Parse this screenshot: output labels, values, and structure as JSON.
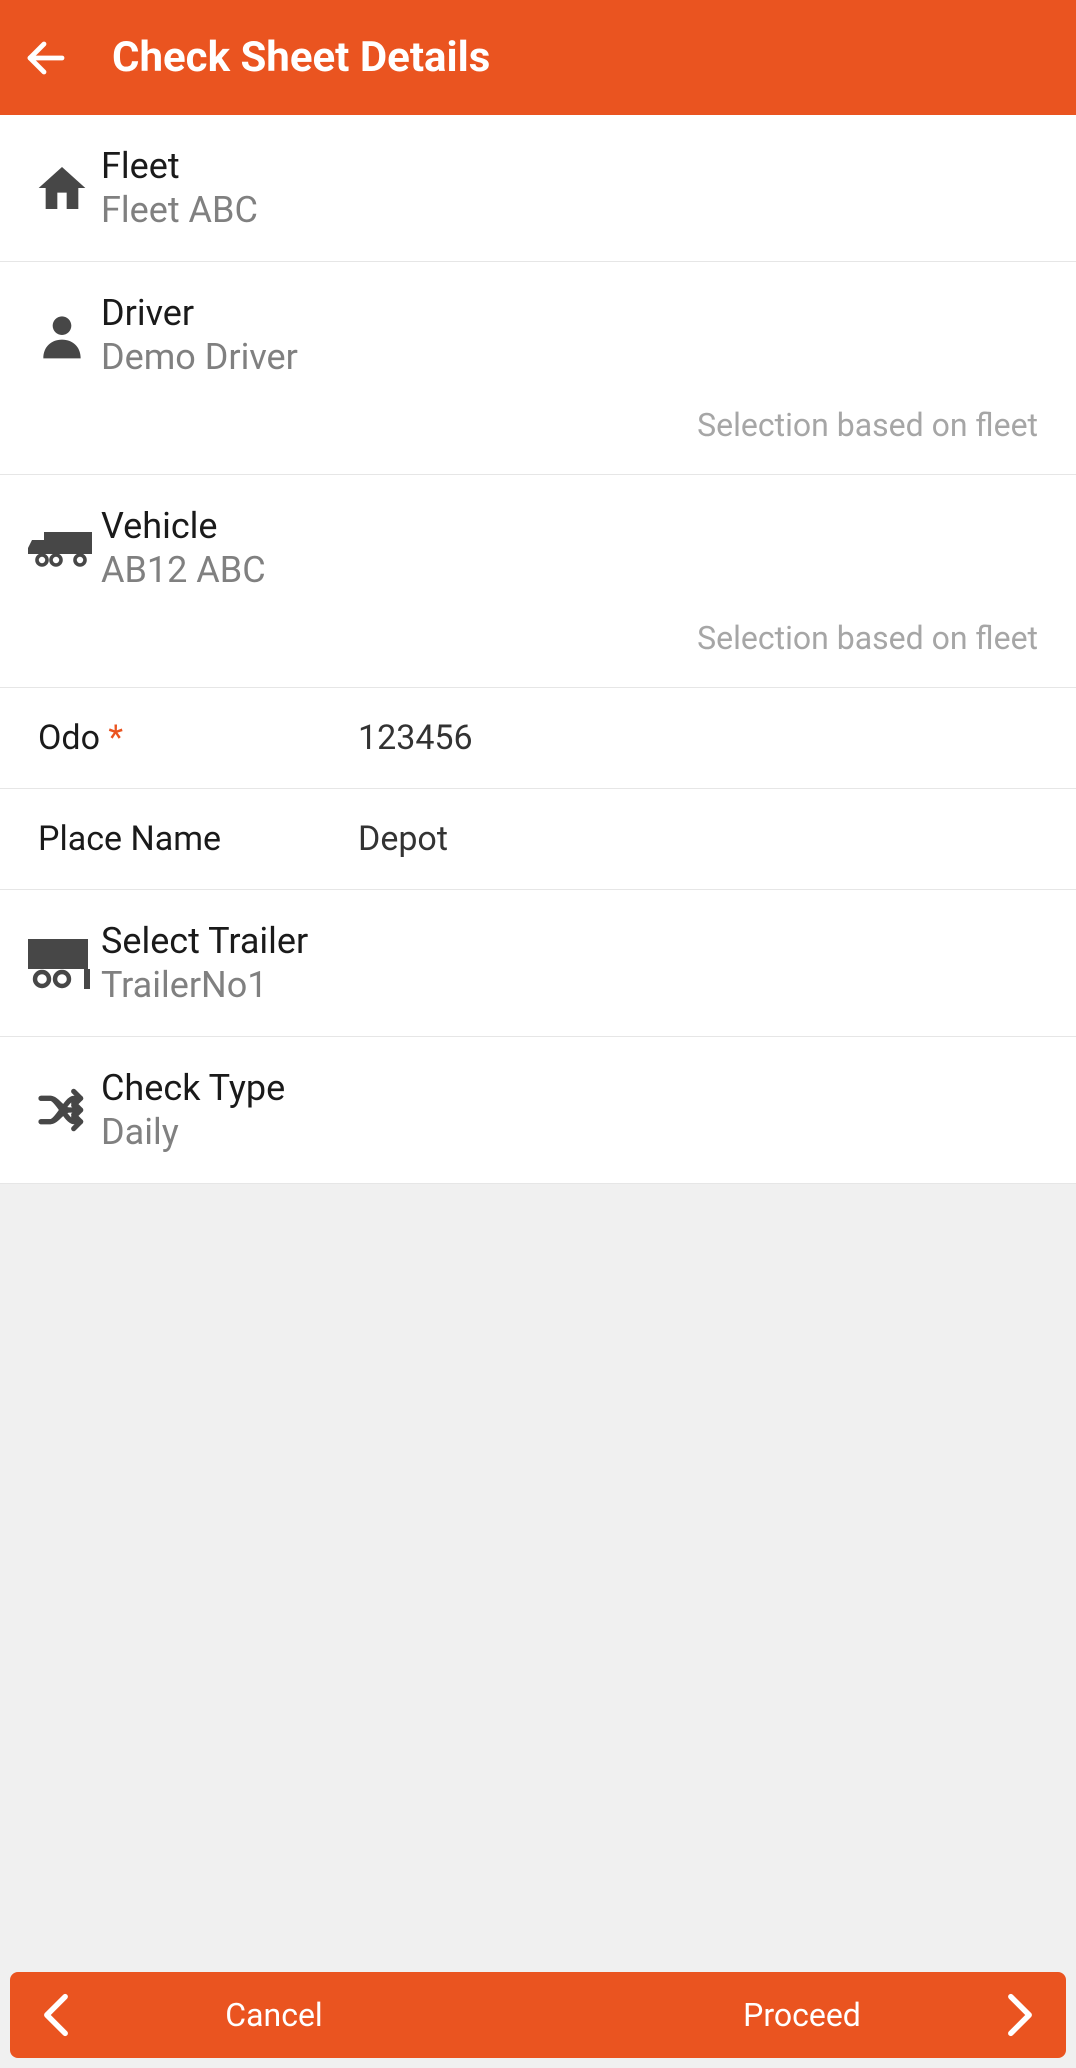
{
  "header": {
    "title": "Check Sheet Details"
  },
  "fleet": {
    "label": "Fleet",
    "value": "Fleet ABC"
  },
  "driver": {
    "label": "Driver",
    "value": "Demo Driver",
    "hint": "Selection based on fleet"
  },
  "vehicle": {
    "label": "Vehicle",
    "value": "AB12 ABC",
    "hint": "Selection based on fleet"
  },
  "odo": {
    "label": "Odo ",
    "required": "*",
    "value": "123456"
  },
  "place": {
    "label": "Place Name",
    "value": "Depot"
  },
  "trailer": {
    "label": "Select Trailer",
    "value": "TrailerNo1"
  },
  "check_type": {
    "label": "Check Type",
    "value": "Daily"
  },
  "footer": {
    "cancel": "Cancel",
    "proceed": "Proceed"
  }
}
